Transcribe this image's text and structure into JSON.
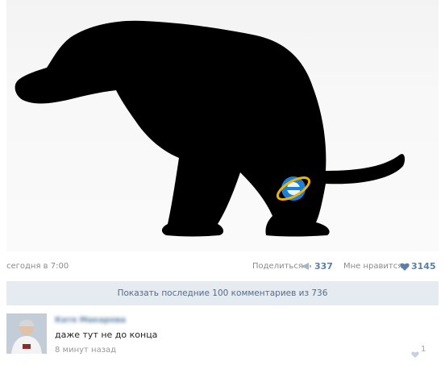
{
  "post": {
    "time": "сегодня в 7:00",
    "share_label": "Поделиться",
    "share_count": "337",
    "like_label": "Мне нравится",
    "like_count": "3145"
  },
  "comments_bar": {
    "label": "Показать последние 100 комментариев из 736"
  },
  "comment": {
    "author": "Катя Макарова",
    "text": "даже тут не до конца",
    "time": "8 минут назад",
    "likes": "1"
  },
  "icons": [
    "megaphone-icon",
    "heart-icon",
    "internet-explorer-icon"
  ],
  "colors": {
    "link": "#5b7fa6",
    "bar_bg": "#e6ebf1",
    "ie_blue": "#1e7fd8",
    "ie_ring": "#f0b400"
  }
}
